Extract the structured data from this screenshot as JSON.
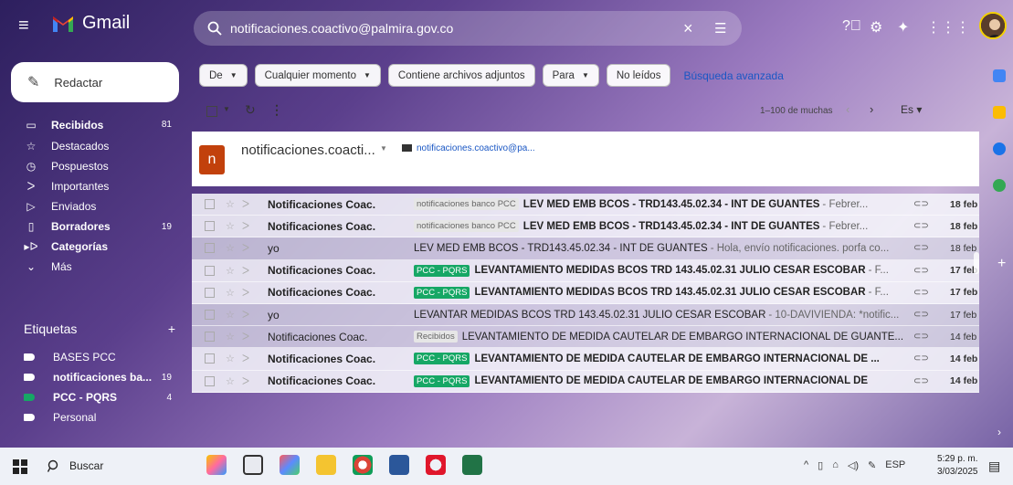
{
  "app": {
    "name": "Gmail"
  },
  "search": {
    "query": "notificaciones.coactivo@palmira.gov.co",
    "icon": "search-icon"
  },
  "sidebar": {
    "compose_label": "Redactar",
    "items": [
      {
        "label": "Recibidos",
        "count": "81",
        "icon": "inbox-icon",
        "bold": true
      },
      {
        "label": "Destacados",
        "count": "",
        "icon": "star-icon",
        "bold": false
      },
      {
        "label": "Pospuestos",
        "count": "",
        "icon": "clock-icon",
        "bold": false
      },
      {
        "label": "Importantes",
        "count": "",
        "icon": "important-icon",
        "bold": false
      },
      {
        "label": "Enviados",
        "count": "",
        "icon": "send-icon",
        "bold": false
      },
      {
        "label": "Borradores",
        "count": "19",
        "icon": "draft-icon",
        "bold": true
      },
      {
        "label": "Categorías",
        "count": "",
        "icon": "category-icon",
        "bold": true
      },
      {
        "label": "Más",
        "count": "",
        "icon": "chevron-down-icon",
        "bold": false
      }
    ],
    "labels_title": "Etiquetas",
    "labels": [
      {
        "label": "BASES PCC",
        "count": "",
        "color": "#ffffff",
        "bold": false
      },
      {
        "label": "notificaciones ba...",
        "count": "19",
        "color": "#ffffff",
        "bold": true
      },
      {
        "label": "PCC - PQRS",
        "count": "4",
        "color": "#16a765",
        "bold": true
      },
      {
        "label": "Personal",
        "count": "",
        "color": "#ffffff",
        "bold": false
      }
    ]
  },
  "filters": {
    "chips": [
      {
        "label": "De",
        "dropdown": true
      },
      {
        "label": "Cualquier momento",
        "dropdown": true
      },
      {
        "label": "Contiene archivos adjuntos",
        "dropdown": false
      },
      {
        "label": "Para",
        "dropdown": true
      },
      {
        "label": "No leídos",
        "dropdown": false
      }
    ],
    "advanced": "Búsqueda avanzada"
  },
  "toolbar": {
    "pager": "1–100 de muchas",
    "lang": "Es"
  },
  "contact": {
    "initial": "n",
    "name": "notificaciones.coacti...",
    "email": "notificaciones.coactivo@pa..."
  },
  "emails": [
    {
      "sender": "Notificaciones Coac.",
      "label": "notificaciones banco PCC",
      "label_style": "gray",
      "subject": "LEV MED EMB BCOS - TRD143.45.02.34 - INT DE GUANTES",
      "snippet": "- Febrer...",
      "date": "18 feb",
      "unread": true
    },
    {
      "sender": "Notificaciones Coac.",
      "label": "notificaciones banco PCC",
      "label_style": "gray",
      "subject": "LEV MED EMB BCOS - TRD143.45.02.34 - INT DE GUANTES",
      "snippet": "- Febrer...",
      "date": "18 feb",
      "unread": true
    },
    {
      "sender": "yo",
      "label": "",
      "label_style": "",
      "subject": "LEV MED EMB BCOS - TRD143.45.02.34 - INT DE GUANTES",
      "snippet": "- Hola, envío notificaciones. porfa co...",
      "date": "18 feb",
      "unread": false
    },
    {
      "sender": "Notificaciones Coac.",
      "label": "PCC - PQRS",
      "label_style": "green",
      "subject": "LEVANTAMIENTO MEDIDAS BCOS TRD 143.45.02.31 JULIO CESAR ESCOBAR",
      "snippet": "- F...",
      "date": "17 feb",
      "unread": true
    },
    {
      "sender": "Notificaciones Coac.",
      "label": "PCC - PQRS",
      "label_style": "green",
      "subject": "LEVANTAMIENTO MEDIDAS BCOS TRD 143.45.02.31 JULIO CESAR ESCOBAR",
      "snippet": "- F...",
      "date": "17 feb",
      "unread": true
    },
    {
      "sender": "yo",
      "label": "",
      "label_style": "",
      "subject": "LEVANTAR MEDIDAS BCOS TRD 143.45.02.31 JULIO CESAR ESCOBAR",
      "snippet": "- 10-DAVIVIENDA: *notific...",
      "date": "17 feb",
      "unread": false
    },
    {
      "sender": "Notificaciones Coac.",
      "label": "Recibidos",
      "label_style": "gray",
      "subject": "LEVANTAMIENTO DE MEDIDA CAUTELAR DE EMBARGO INTERNACIONAL DE GUANTE...",
      "snippet": "",
      "date": "14 feb",
      "unread": false
    },
    {
      "sender": "Notificaciones Coac.",
      "label": "PCC - PQRS",
      "label_style": "green",
      "subject": "LEVANTAMIENTO DE MEDIDA CAUTELAR DE EMBARGO INTERNACIONAL DE ...",
      "snippet": "",
      "date": "14 feb",
      "unread": true
    },
    {
      "sender": "Notificaciones Coac.",
      "label": "PCC - PQRS",
      "label_style": "green",
      "subject": "LEVANTAMIENTO DE MEDIDA CAUTELAR DE EMBARGO INTERNACIONAL DE",
      "snippet": "",
      "date": "14 feb",
      "unread": true
    }
  ],
  "taskbar": {
    "search_label": "Buscar",
    "lang": "ESP",
    "time": "5:29 p. m.",
    "date": "3/03/2025"
  },
  "colors": {
    "accent_green": "#16a765",
    "link_blue": "#1a57c4",
    "avatar_orange": "#c2410c"
  }
}
